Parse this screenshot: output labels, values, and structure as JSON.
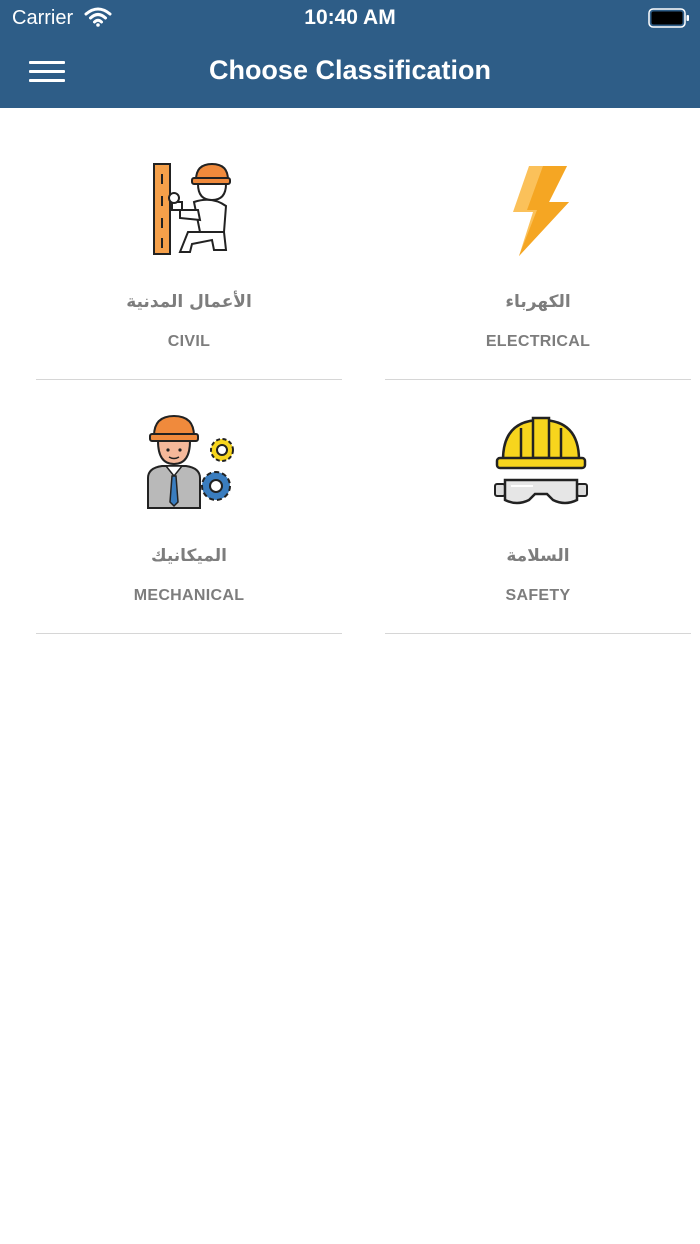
{
  "status_bar": {
    "carrier": "Carrier",
    "time": "10:40 AM"
  },
  "nav": {
    "title": "Choose Classification",
    "menu_icon": "hamburger-menu-icon"
  },
  "classifications": [
    {
      "label_ar": "الكهرباء",
      "label_en": "ELECTRICAL",
      "icon": "lightning-bolt-icon"
    },
    {
      "label_ar": "الأعمال المدنية",
      "label_en": "CIVIL",
      "icon": "construction-worker-icon"
    },
    {
      "label_ar": "السلامة",
      "label_en": "SAFETY",
      "icon": "hardhat-goggles-icon"
    },
    {
      "label_ar": "الميكانيك",
      "label_en": "MECHANICAL",
      "icon": "engineer-gears-icon"
    }
  ],
  "colors": {
    "nav_bg": "#2e5d87",
    "label_gray": "#7d7d7d",
    "divider": "#d6d6d6",
    "bolt_orange": "#f5a623",
    "helmet_yellow": "#f7d51d",
    "helmet_orange": "#f08a3c"
  }
}
